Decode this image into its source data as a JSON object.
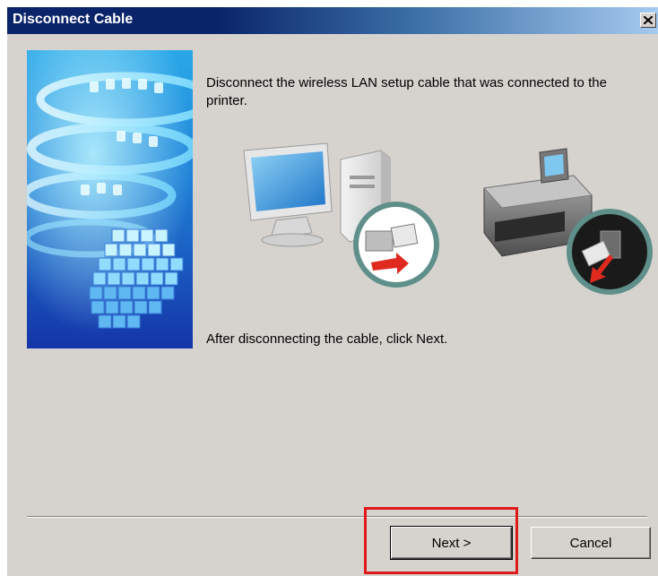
{
  "window": {
    "title": "Disconnect Cable",
    "close_icon": "close-x-icon"
  },
  "main": {
    "instruction": "Disconnect the wireless LAN setup cable that was connected to the printer.",
    "after_instruction": "After disconnecting the cable, click Next.",
    "illustration_icons": [
      "computer-icon",
      "usb-unplug-icon",
      "printer-icon",
      "usb-unplug-icon"
    ]
  },
  "buttons": {
    "next_label": "Next >",
    "cancel_label": "Cancel"
  },
  "colors": {
    "titlebar_start": "#0a246a",
    "titlebar_end": "#a6caf0",
    "dialog_bg": "#d6d3ce",
    "highlight": "#e0191b",
    "arrow_red": "#e02a1f",
    "callout_teal": "#5f8f8a"
  }
}
